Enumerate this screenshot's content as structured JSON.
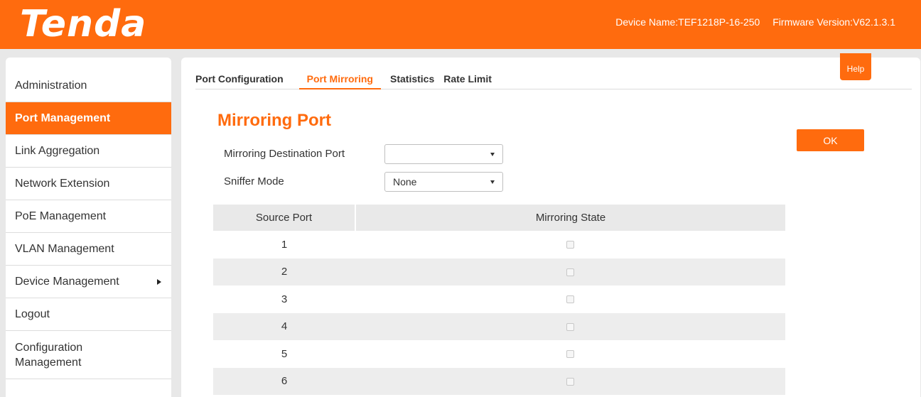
{
  "header": {
    "logo": "Tenda",
    "device_name": "Device Name:TEF1218P-16-250",
    "firmware_version": "Firmware Version:V62.1.3.1"
  },
  "sidebar": {
    "items": [
      {
        "label": "Administration"
      },
      {
        "label": "Port Management",
        "active": true
      },
      {
        "label": "Link Aggregation"
      },
      {
        "label": "Network Extension"
      },
      {
        "label": "PoE Management"
      },
      {
        "label": "VLAN Management"
      },
      {
        "label": "Device Management",
        "has_submenu": true
      },
      {
        "label": "Logout"
      },
      {
        "label": "Configuration Management"
      }
    ]
  },
  "tabs": [
    {
      "label": "Port Configuration"
    },
    {
      "label": "Port Mirroring",
      "active": true
    },
    {
      "label": "Statistics"
    },
    {
      "label": "Rate Limit"
    }
  ],
  "help_label": "Help",
  "page_title": "Mirroring Port",
  "ok_label": "OK",
  "form": {
    "destination_label": "Mirroring Destination Port",
    "destination_value": "",
    "sniffer_label": "Sniffer Mode",
    "sniffer_value": "None"
  },
  "table": {
    "headers": [
      "Source Port",
      "Mirroring State"
    ],
    "rows": [
      {
        "port": "1",
        "checked": false
      },
      {
        "port": "2",
        "checked": false
      },
      {
        "port": "3",
        "checked": false
      },
      {
        "port": "4",
        "checked": false
      },
      {
        "port": "5",
        "checked": false
      },
      {
        "port": "6",
        "checked": false
      }
    ]
  },
  "colors": {
    "brand": "#ff6b0e"
  }
}
